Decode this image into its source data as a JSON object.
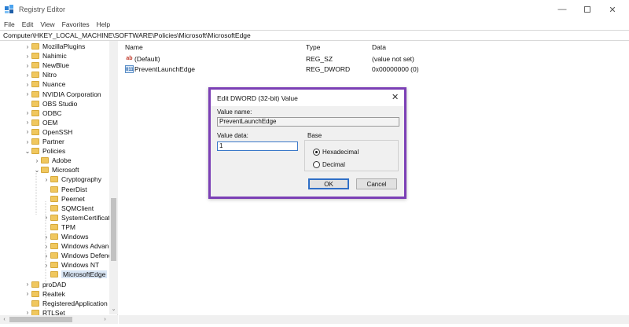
{
  "window": {
    "title": "Registry Editor",
    "minimize_glyph": "—",
    "close_glyph": "✕"
  },
  "menu": [
    "File",
    "Edit",
    "View",
    "Favorites",
    "Help"
  ],
  "address": "Computer\\HKEY_LOCAL_MACHINE\\SOFTWARE\\Policies\\Microsoft\\MicrosoftEdge",
  "tree": {
    "items": [
      {
        "label": "MozillaPlugins",
        "expander": "›"
      },
      {
        "label": "Nahimic",
        "expander": "›"
      },
      {
        "label": "NewBlue",
        "expander": "›"
      },
      {
        "label": "Nitro",
        "expander": "›"
      },
      {
        "label": "Nuance",
        "expander": "›"
      },
      {
        "label": "NVIDIA Corporation",
        "expander": "›"
      },
      {
        "label": "OBS Studio",
        "expander": ""
      },
      {
        "label": "ODBC",
        "expander": "›"
      },
      {
        "label": "OEM",
        "expander": "›"
      },
      {
        "label": "OpenSSH",
        "expander": "›"
      },
      {
        "label": "Partner",
        "expander": "›"
      },
      {
        "label": "Policies",
        "expander": "⌄"
      },
      {
        "label": "Adobe",
        "expander": "›"
      },
      {
        "label": "Microsoft",
        "expander": "⌄"
      },
      {
        "label": "Cryptography",
        "expander": "›"
      },
      {
        "label": "PeerDist",
        "expander": ""
      },
      {
        "label": "Peernet",
        "expander": ""
      },
      {
        "label": "SQMClient",
        "expander": ""
      },
      {
        "label": "SystemCertificate",
        "expander": "›"
      },
      {
        "label": "TPM",
        "expander": ""
      },
      {
        "label": "Windows",
        "expander": "›"
      },
      {
        "label": "Windows Advanc",
        "expander": "›"
      },
      {
        "label": "Windows Defenc",
        "expander": "›"
      },
      {
        "label": "Windows NT",
        "expander": "›"
      },
      {
        "label": "MicrosoftEdge",
        "expander": ""
      },
      {
        "label": "proDAD",
        "expander": "›"
      },
      {
        "label": "Realtek",
        "expander": "›"
      },
      {
        "label": "RegisteredApplication",
        "expander": ""
      },
      {
        "label": "RTLSet",
        "expander": "›"
      }
    ],
    "scroll_down_glyph": "⌄",
    "scroll_left_glyph": "‹",
    "scroll_right_glyph": "›"
  },
  "list": {
    "headers": {
      "name": "Name",
      "type": "Type",
      "data": "Data"
    },
    "rows": [
      {
        "icon": "ab",
        "name": "(Default)",
        "type": "REG_SZ",
        "data": "(value not set)"
      },
      {
        "icon": "011",
        "name": "PreventLaunchEdge",
        "type": "REG_DWORD",
        "data": "0x00000000 (0)"
      }
    ]
  },
  "dialog": {
    "title": "Edit DWORD (32-bit) Value",
    "close_glyph": "✕",
    "value_name_label": "Value name:",
    "value_name": "PreventLaunchEdge",
    "value_data_label": "Value data:",
    "value_data": "1",
    "base_label": "Base",
    "hex_label": "Hexadecimal",
    "dec_label": "Decimal",
    "selected_base": "Hexadecimal",
    "ok_label": "OK",
    "cancel_label": "Cancel"
  },
  "colors": {
    "dialog_highlight": "#7b3fb5",
    "folder": "#f0c75e",
    "selection": "#d9e6f5"
  }
}
